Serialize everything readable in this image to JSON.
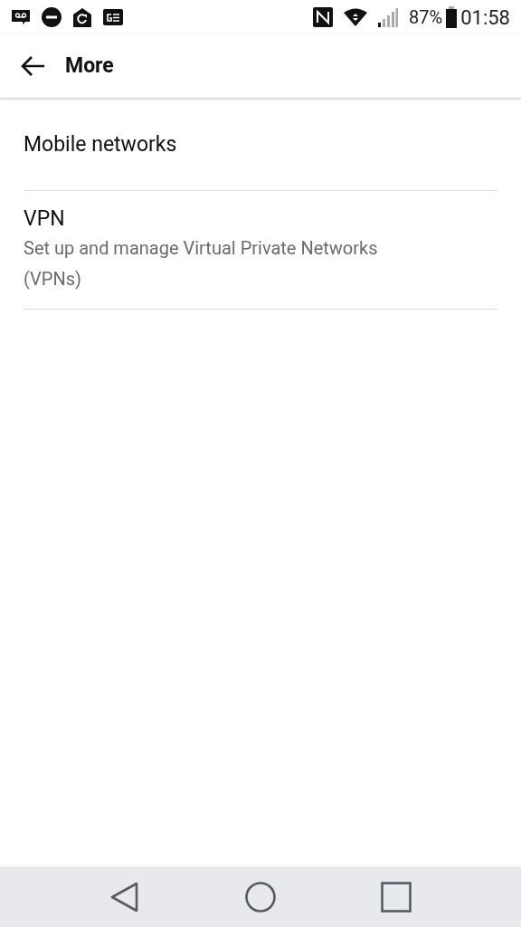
{
  "status_bar": {
    "battery_text": "87%",
    "time": "01:58"
  },
  "toolbar": {
    "title": "More"
  },
  "items": [
    {
      "title": "Mobile networks"
    },
    {
      "title": "VPN",
      "summary": "Set up and manage Virtual Private Networks (VPNs)"
    }
  ]
}
